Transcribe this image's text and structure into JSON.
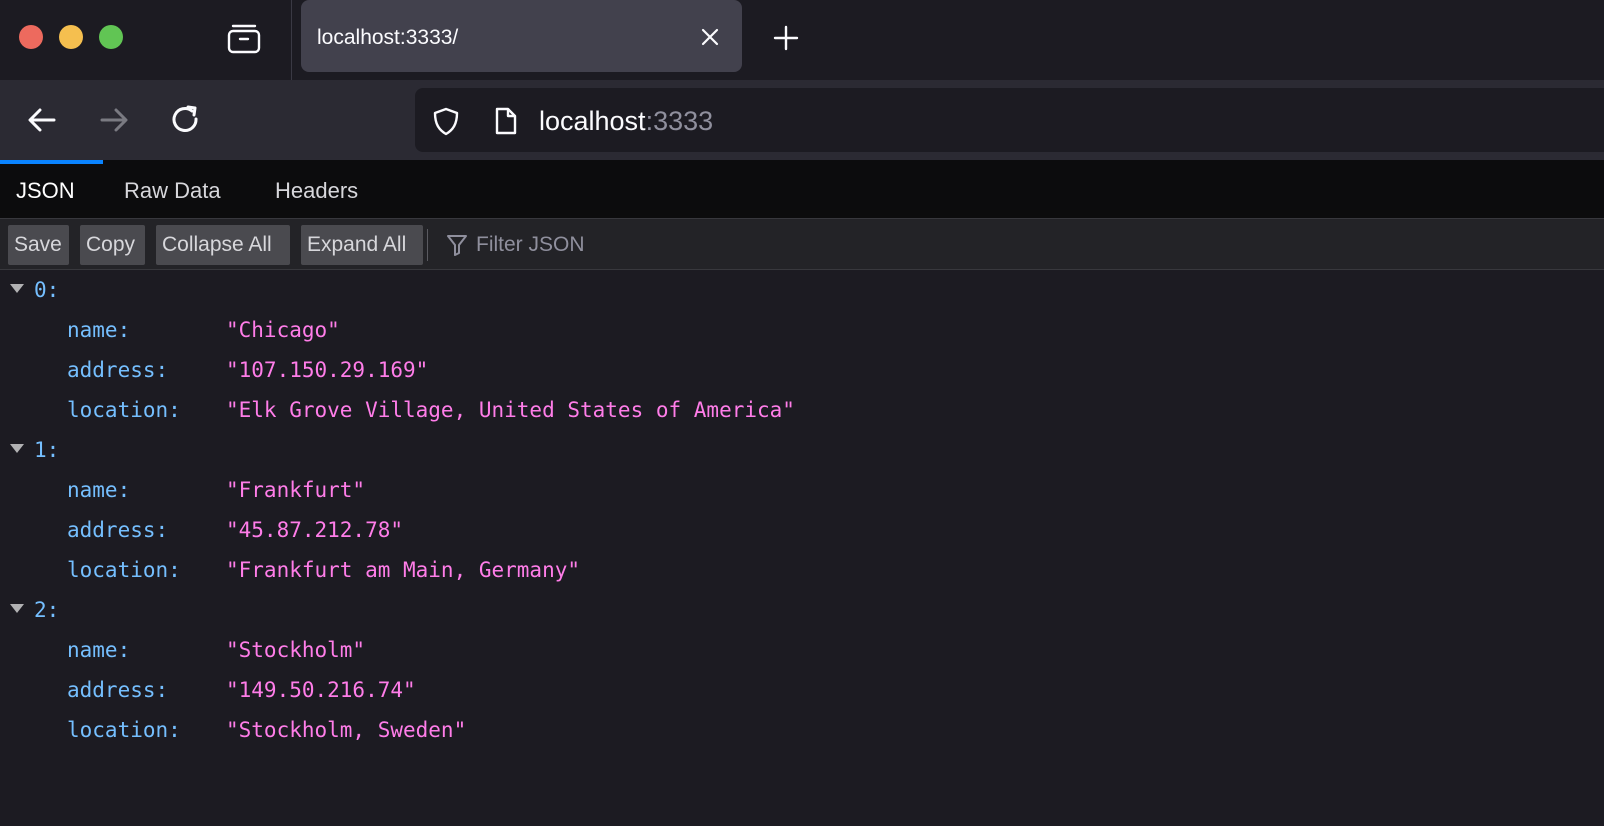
{
  "browser": {
    "tab": {
      "title": "localhost:3333/"
    },
    "urlbar": {
      "host": "localhost",
      "port": ":3333"
    }
  },
  "viewer": {
    "tabs": [
      "JSON",
      "Raw Data",
      "Headers"
    ],
    "toolbar": {
      "save": "Save",
      "copy": "Copy",
      "collapse_all": "Collapse All",
      "expand_all": "Expand All",
      "filter_placeholder": "Filter JSON"
    }
  },
  "json": {
    "items": [
      {
        "index": "0:",
        "fields": [
          {
            "key": "name:",
            "value": "\"Chicago\""
          },
          {
            "key": "address:",
            "value": "\"107.150.29.169\""
          },
          {
            "key": "location:",
            "value": "\"Elk Grove Village, United States of America\""
          }
        ]
      },
      {
        "index": "1:",
        "fields": [
          {
            "key": "name:",
            "value": "\"Frankfurt\""
          },
          {
            "key": "address:",
            "value": "\"45.87.212.78\""
          },
          {
            "key": "location:",
            "value": "\"Frankfurt am Main, Germany\""
          }
        ]
      },
      {
        "index": "2:",
        "fields": [
          {
            "key": "name:",
            "value": "\"Stockholm\""
          },
          {
            "key": "address:",
            "value": "\"149.50.216.74\""
          },
          {
            "key": "location:",
            "value": "\"Stockholm, Sweden\""
          }
        ]
      }
    ]
  },
  "colors": {
    "key": "#75bfff",
    "string": "#ff7de9",
    "accent": "#0a84ff"
  }
}
